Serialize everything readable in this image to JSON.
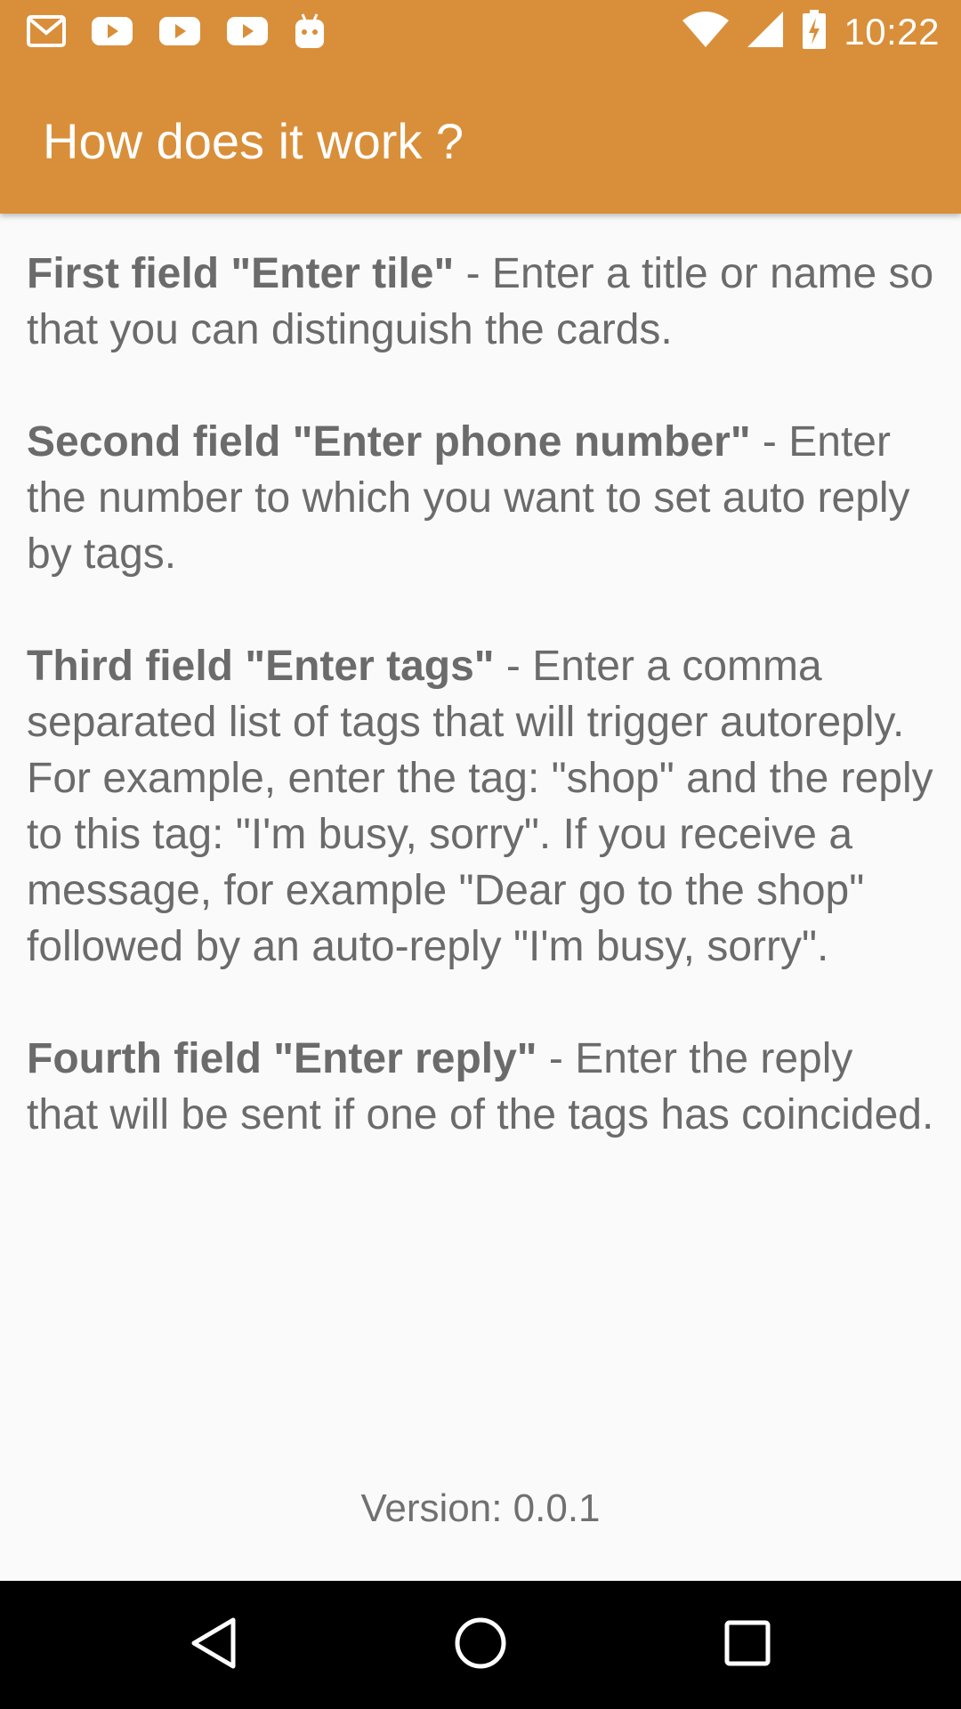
{
  "status_bar": {
    "time": "10:22",
    "notification_icons": [
      "gmail-icon",
      "youtube-icon",
      "youtube-icon",
      "youtube-icon",
      "android-icon"
    ],
    "system_icons": [
      "wifi-icon",
      "cell-signal-icon",
      "battery-charging-icon"
    ]
  },
  "app_bar": {
    "title": "How does it work ?",
    "color": "#d98f3a"
  },
  "instructions": [
    {
      "bold": "First field \"Enter tile\"",
      "text": " - Enter a title or name so that you can distinguish the cards."
    },
    {
      "bold": "Second field \"Enter phone number\"",
      "text": " - Enter the number to which you want to set auto reply by tags."
    },
    {
      "bold": "Third field \"Enter tags\"",
      "text": " - Enter a comma separated list of tags that will trigger autoreply. For example, enter the tag: \"shop\" and the reply to this tag: \"I'm busy, sorry\". If you receive a message, for example \"Dear go to the shop\" followed by an auto-reply \"I'm busy, sorry\"."
    },
    {
      "bold": "Fourth field \"Enter reply\"",
      "text": " - Enter the reply that will be sent if one of the tags has coincided."
    }
  ],
  "version": "Version: 0.0.1",
  "nav_bar": {
    "buttons": [
      "back-icon",
      "home-icon",
      "recents-icon"
    ]
  }
}
